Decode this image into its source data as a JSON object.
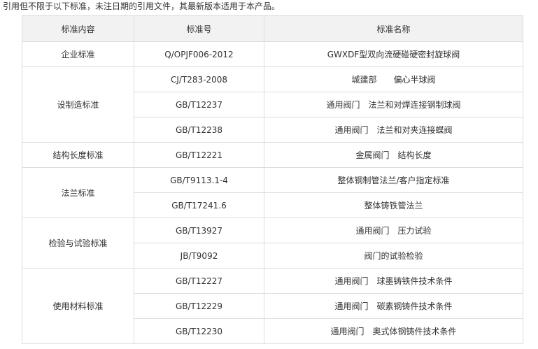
{
  "intro_text": "引用但不限于以下标准，未注日期的引用文件，其最新版本适用于本产品。",
  "table": {
    "headers": [
      "标准内容",
      "标准号",
      "标准名称"
    ],
    "groups": [
      {
        "category": "企业标准",
        "rows": [
          {
            "number": "Q/OPJF006-2012",
            "name": "GWXDF型双向流硬碰硬密封旋球阀"
          }
        ]
      },
      {
        "category": "设制造标准",
        "rows": [
          {
            "number": "CJ/T283-2008",
            "name": "城建部　　偏心半球阀"
          },
          {
            "number": "GB/T12237",
            "name": "通用阀门　法兰和对焊连接钢制球阀"
          },
          {
            "number": "GB/T12238",
            "name": "通用阀门　法兰和对夹连接蝶阀"
          }
        ]
      },
      {
        "category": "结构长度标准",
        "rows": [
          {
            "number": "GB/T12221",
            "name": "金属阀门　结构长度"
          }
        ]
      },
      {
        "category": "法兰标准",
        "rows": [
          {
            "number": "GB/T9113.1-4",
            "name": "整体钢制管法兰/客户指定标准"
          },
          {
            "number": "GB/T17241.6",
            "name": "整体铸铁管法兰"
          }
        ]
      },
      {
        "category": "检验与试验标准",
        "rows": [
          {
            "number": "GB/T13927",
            "name": "通用阀门　压力试验"
          },
          {
            "number": "JB/T9092",
            "name": "阀门的试验检验"
          }
        ]
      },
      {
        "category": "使用材料标准",
        "rows": [
          {
            "number": "GB/T12227",
            "name": "通用阀门　球墨铸铁件技术条件"
          },
          {
            "number": "GB/T12229",
            "name": "通用阀门　碳素钢铸件技术条件"
          },
          {
            "number": "GB/T12230",
            "name": "通用阀门　奥式体钢铸件技术条件"
          }
        ]
      }
    ]
  }
}
